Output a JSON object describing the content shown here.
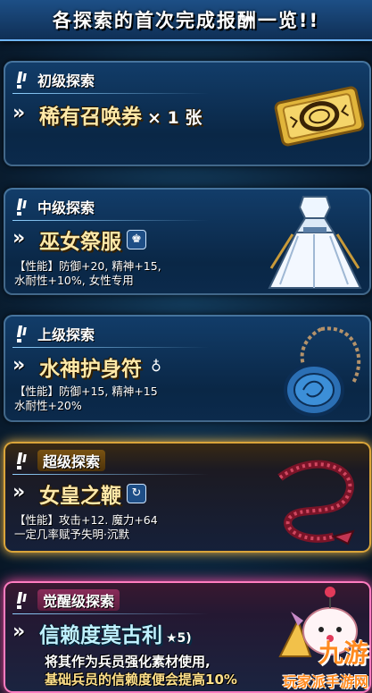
{
  "banner": {
    "title": "各探索的首次完成报酬一览!!"
  },
  "panels": [
    {
      "tier_label": "初级探索",
      "item_name": "稀有召唤券",
      "item_qty": "× 1 张",
      "stats": [],
      "art": "gold-ticket"
    },
    {
      "tier_label": "中级探索",
      "item_name": "巫女祭服",
      "badge_icon": "armor-icon",
      "stats": [
        "【性能】防御+20, 精神+15,",
        "水耐性+10%, 女性专用"
      ],
      "art": "white-robe"
    },
    {
      "tier_label": "上级探索",
      "item_name": "水神护身符",
      "badge_icon": "accessory-icon",
      "stats": [
        "【性能】防御+15, 精神+15",
        "水耐性+20%"
      ],
      "art": "blue-amulet"
    },
    {
      "tier_label": "超级探索",
      "item_name": "女皇之鞭",
      "badge_icon": "whip-icon",
      "stats": [
        "【性能】攻击+12. 魔力+64",
        "一定几率赋予失明·沉默"
      ],
      "art": "red-whip"
    },
    {
      "tier_label": "觉醒级探索",
      "item_name": "信赖度莫古利",
      "item_star": "★5)",
      "desc": [
        "将其作为兵员强化素材使用,",
        "基础兵员的信赖度便会提高10%"
      ],
      "art": "moogle"
    }
  ],
  "watermark": {
    "logo": "九游",
    "text": "玩家派手游网"
  },
  "colors": {
    "gold_frame": "#d9a43a",
    "pink_frame": "#ff7cc0",
    "item_text": "#ffe9a8"
  }
}
